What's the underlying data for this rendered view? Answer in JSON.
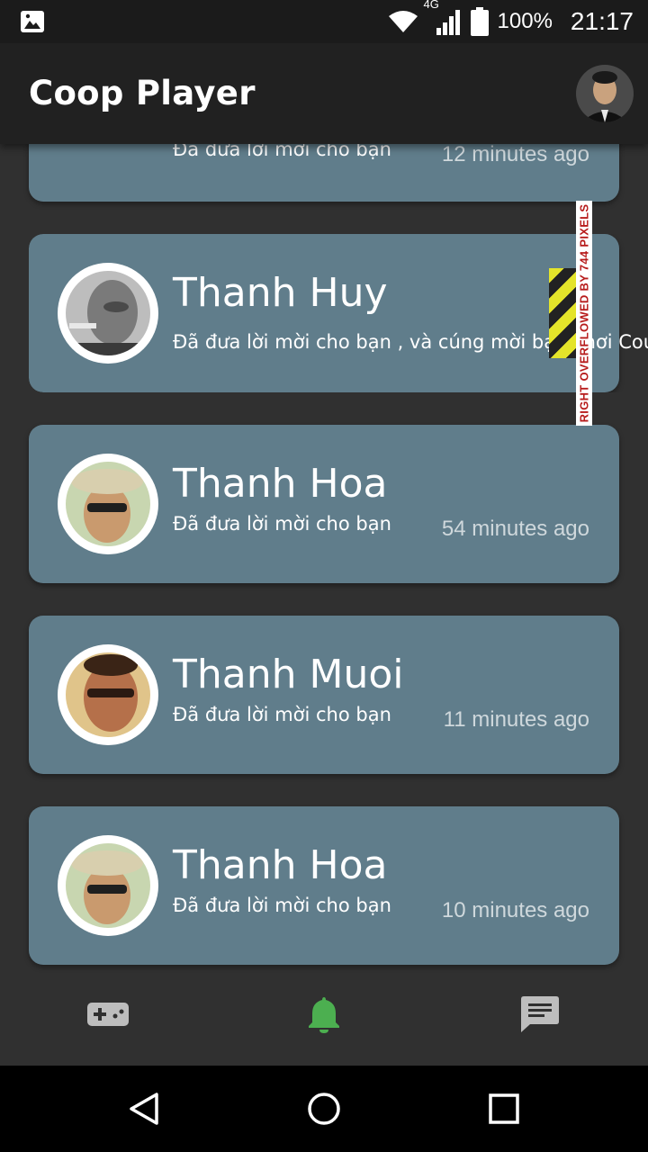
{
  "status_bar": {
    "network": "4G",
    "battery": "100%",
    "time": "21:17"
  },
  "app_bar": {
    "title": "Coop Player"
  },
  "notifications": [
    {
      "name": "",
      "message": "Đã đưa lời mời cho bạn",
      "time": "12 minutes ago"
    },
    {
      "name": "Thanh Huy",
      "message": "Đã đưa lời mời cho bạn , và cúng mời bạn chơi Coun",
      "time": ""
    },
    {
      "name": "Thanh Hoa",
      "message": "Đã đưa lời mời cho bạn",
      "time": "54 minutes ago"
    },
    {
      "name": "Thanh Muoi",
      "message": "Đã đưa lời mời cho bạn",
      "time": "11 minutes ago"
    },
    {
      "name": "Thanh Hoa",
      "message": "Đã đưa lời mời cho bạn",
      "time": "10 minutes ago"
    }
  ],
  "overflow_warning": "RIGHT OVERFLOWED BY 744 PIXELS",
  "bottom_nav": {
    "items": [
      {
        "icon": "gamepad-icon",
        "active": false
      },
      {
        "icon": "bell-icon",
        "active": true
      },
      {
        "icon": "chat-icon",
        "active": false
      }
    ],
    "active_color": "#4caf50",
    "inactive_color": "#bdbdbd"
  },
  "colors": {
    "card": "#607d8b",
    "app_bar": "#212121",
    "background": "#303030"
  }
}
